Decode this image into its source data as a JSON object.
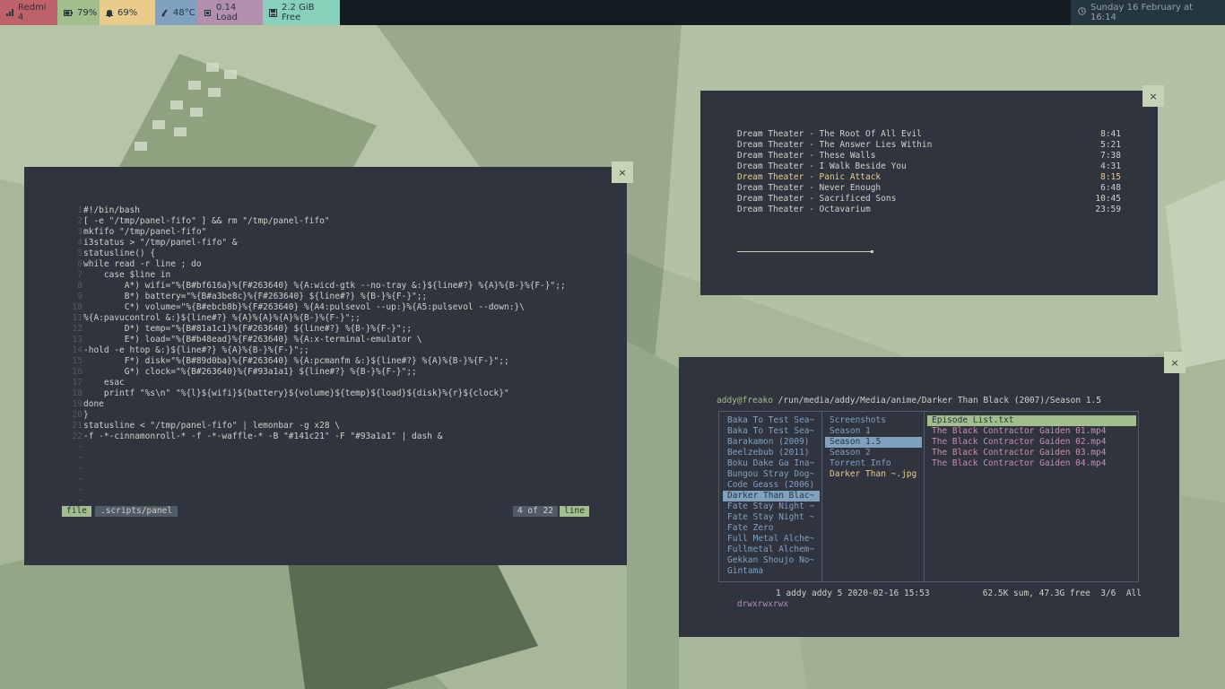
{
  "statusbar": {
    "wifi": "Redmi 4",
    "battery": "79%",
    "volume": "69%",
    "temp": "48°C",
    "load": "0.14 Load",
    "disk": "2.2 GiB Free",
    "clock": "Sunday 16 February at 16:14",
    "colors": {
      "bar_bg": "#141c21",
      "wifi": "#bf616a",
      "battery": "#a3be8c",
      "volume": "#ebcb8b",
      "temp": "#81a1c1",
      "load": "#b48ead",
      "disk": "#89d0ba",
      "clock_bg": "#263640"
    }
  },
  "editor": {
    "close": "×",
    "lines": [
      {
        "n": "1",
        "t": "#!/bin/bash"
      },
      {
        "n": "2",
        "t": "[ -e \"/tmp/panel-fifo\" ] && rm \"/tmp/panel-fifo\""
      },
      {
        "n": "3",
        "t": "mkfifo \"/tmp/panel-fifo\""
      },
      {
        "n": "4",
        "t": "i3status > \"/tmp/panel-fifo\" &"
      },
      {
        "n": "5",
        "t": "statusline() {"
      },
      {
        "n": "6",
        "t": "while read -r line ; do"
      },
      {
        "n": "7",
        "t": "    case $line in"
      },
      {
        "n": "8",
        "t": "        A*) wifi=\"%{B#bf616a}%{F#263640} %{A:wicd-gtk --no-tray &:}${line#?} %{A}%{B-}%{F-}\";;"
      },
      {
        "n": "9",
        "t": "        B*) battery=\"%{B#a3be8c}%{F#263640} ${line#?} %{B-}%{F-}\";;"
      },
      {
        "n": "10",
        "t": "        C*) volume=\"%{B#ebcb8b}%{F#263640} %{A4:pulsevol --up:}%{A5:pulsevol --down:}\\"
      },
      {
        "n": "11",
        "t": "%{A:pavucontrol &:}${line#?} %{A}%{A}%{A}%{B-}%{F-}\";;"
      },
      {
        "n": "12",
        "t": "        D*) temp=\"%{B#81a1c1}%{F#263640} ${line#?} %{B-}%{F-}\";;"
      },
      {
        "n": "13",
        "t": "        E*) load=\"%{B#b48ead}%{F#263640} %{A:x-terminal-emulator \\"
      },
      {
        "n": "14",
        "t": "-hold -e htop &:}${line#?} %{A}%{B-}%{F-}\";;"
      },
      {
        "n": "15",
        "t": "        F*) disk=\"%{B#89d0ba}%{F#263640} %{A:pcmanfm &:}${line#?} %{A}%{B-}%{F-}\";;"
      },
      {
        "n": "16",
        "t": "        G*) clock=\"%{B#263640}%{F#93a1a1} ${line#?} %{B-}%{F-}\";;"
      },
      {
        "n": "17",
        "t": "    esac"
      },
      {
        "n": "18",
        "t": "    printf \"%s\\n\" \"%{l}${wifi}${battery}${volume}${temp}${load}${disk}%{r}${clock}\""
      },
      {
        "n": "19",
        "t": "done"
      },
      {
        "n": "20",
        "t": "}"
      },
      {
        "n": "21",
        "t": "statusline < \"/tmp/panel-fifo\" | lemonbar -g x28 \\"
      },
      {
        "n": "22",
        "t": "-f -*-cinnamonroll-* -f -*-waffle-* -B \"#141c21\" -F \"#93a1a1\" | dash &"
      },
      {
        "n": "~",
        "t": ""
      },
      {
        "n": "~",
        "t": ""
      },
      {
        "n": "~",
        "t": ""
      },
      {
        "n": "~",
        "t": ""
      },
      {
        "n": "~",
        "t": ""
      },
      {
        "n": "~",
        "t": ""
      }
    ],
    "status": {
      "mode": "file",
      "filename": ".scripts/panel",
      "position": "4 of 22",
      "type": "line"
    }
  },
  "player": {
    "close": "×",
    "tracks": [
      {
        "title": "Dream Theater - The Root Of All Evil",
        "time": "8:41"
      },
      {
        "title": "Dream Theater - The Answer Lies Within",
        "time": "5:21"
      },
      {
        "title": "Dream Theater - These Walls",
        "time": "7:38"
      },
      {
        "title": "Dream Theater - I Walk Beside You",
        "time": "4:31"
      },
      {
        "title": "Dream Theater - Panic Attack",
        "time": "8:15"
      },
      {
        "title": "Dream Theater - Never Enough",
        "time": "6:48"
      },
      {
        "title": "Dream Theater - Sacrificed Sons",
        "time": "10:45"
      },
      {
        "title": "Dream Theater - Octavarium",
        "time": "23:59"
      }
    ],
    "active_index": 4,
    "progress": 0.35
  },
  "filemanager": {
    "close": "×",
    "prompt_user": "addy@freako",
    "path": "/run/media/addy/Media/anime/Darker Than Black (2007)/Season 1.5",
    "col1": [
      "Baka To Test Sea~",
      "Baka To Test Sea~",
      "Barakamon (2009)",
      "Beelzebub (2011)",
      "Boku Dake Ga Ina~",
      "Bungou Stray Dog~",
      "Code Geass (2006)",
      "Darker Than Blac~",
      "Fate Stay Night ~",
      "Fate Stay Night ~",
      "Fate Zero",
      "Full Metal Alche~",
      "Fullmetal Alchem~",
      "Gekkan Shoujo No~",
      "Gintama"
    ],
    "col1_selected": 7,
    "col2": [
      "Screenshots",
      "Season 1",
      "Season 1.5",
      "Season 2",
      "Torrent Info",
      "Darker Than ~.jpg"
    ],
    "col2_selected": 2,
    "col3": [
      "Episode List.txt",
      "The Black Contractor Gaiden 01.mp4",
      "The Black Contractor Gaiden 02.mp4",
      "The Black Contractor Gaiden 03.mp4",
      "The Black Contractor Gaiden 04.mp4"
    ],
    "col3_selected": 0,
    "status_perm": "drwxrwxrwx",
    "status_meta": "1 addy addy 5 2020-02-16 15:53",
    "status_free": "62.5K sum, 47.3G free  3/6  All"
  }
}
